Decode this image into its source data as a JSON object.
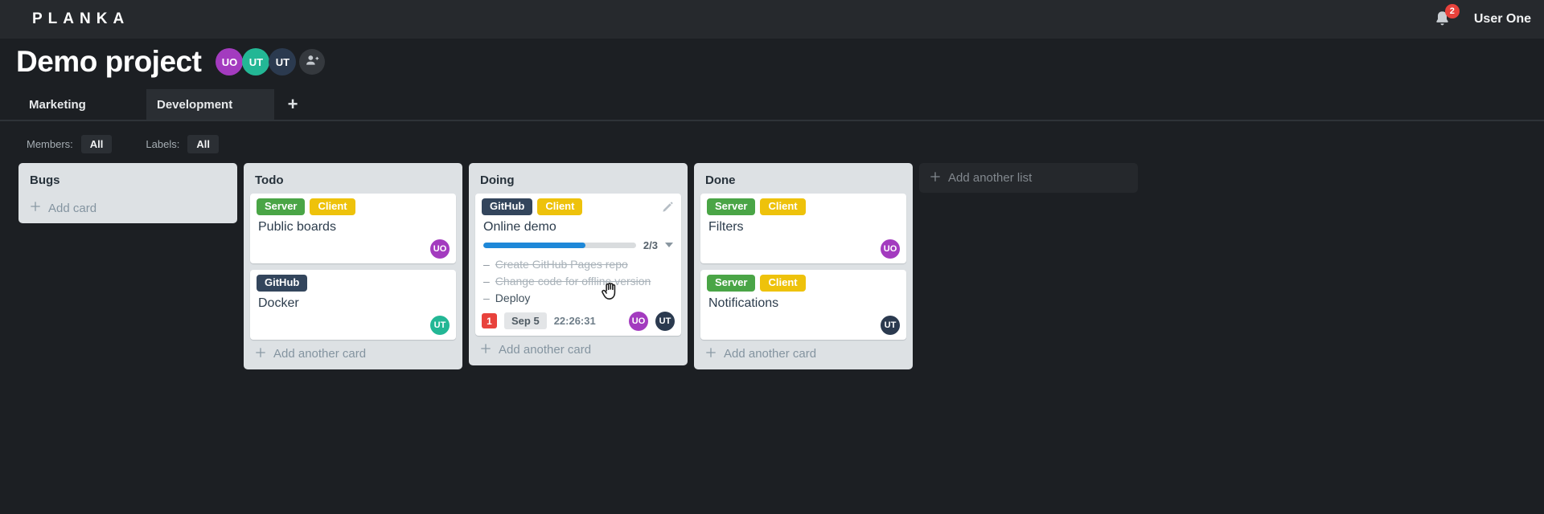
{
  "header": {
    "logo": "PLANKA",
    "notifications_count": "2",
    "user_name": "User One"
  },
  "project": {
    "title": "Demo project",
    "members": [
      {
        "initials": "UO"
      },
      {
        "initials": "UT"
      },
      {
        "initials": "UT"
      }
    ]
  },
  "tabs": {
    "items": [
      {
        "label": "Marketing",
        "active": false
      },
      {
        "label": "Development",
        "active": true
      }
    ],
    "add_button": "+"
  },
  "filters": {
    "members_label": "Members:",
    "members_value": "All",
    "labels_label": "Labels:",
    "labels_value": "All"
  },
  "task_bullet": "–",
  "board": {
    "add_list_label": "Add another list",
    "lists": [
      {
        "title": "Bugs",
        "add_card_label": "Add card",
        "cards": []
      },
      {
        "title": "Todo",
        "add_card_label": "Add another card",
        "cards": [
          {
            "title": "Public boards",
            "labels": [
              {
                "text": "Server"
              },
              {
                "text": "Client"
              }
            ],
            "member": "UO"
          },
          {
            "title": "Docker",
            "labels": [
              {
                "text": "GitHub"
              }
            ],
            "member": "UT"
          }
        ]
      },
      {
        "title": "Doing",
        "add_card_label": "Add another card",
        "cards": [
          {
            "title": "Online demo",
            "labels": [
              {
                "text": "GitHub"
              },
              {
                "text": "Client"
              }
            ],
            "progress": {
              "display": "2/3",
              "percent": 67
            },
            "tasks": [
              {
                "text": "Create GitHub Pages repo",
                "done": true
              },
              {
                "text": "Change code for offline version",
                "done": true
              },
              {
                "text": "Deploy",
                "done": false
              }
            ],
            "notification_count": "1",
            "due_date": "Sep 5",
            "timer": "22:26:31",
            "members": [
              "UO",
              "UT"
            ]
          }
        ]
      },
      {
        "title": "Done",
        "add_card_label": "Add another card",
        "cards": [
          {
            "title": "Filters",
            "labels": [
              {
                "text": "Server"
              },
              {
                "text": "Client"
              }
            ],
            "member": "UO"
          },
          {
            "title": "Notifications",
            "labels": [
              {
                "text": "Server"
              },
              {
                "text": "Client"
              }
            ],
            "member": "UT"
          }
        ]
      }
    ]
  },
  "colors": {
    "label_server": "#4aa546",
    "label_client": "#eec20b",
    "label_github": "#33455c",
    "avatar_purple": "#a33bbf",
    "avatar_teal": "#23b795",
    "avatar_dark": "#2b3a4f",
    "progress_blue": "#1e88d8",
    "notification_red": "#e8423c",
    "list_background": "#dde1e4",
    "appbar_background": "#26292d",
    "page_background": "#1c1f23"
  }
}
